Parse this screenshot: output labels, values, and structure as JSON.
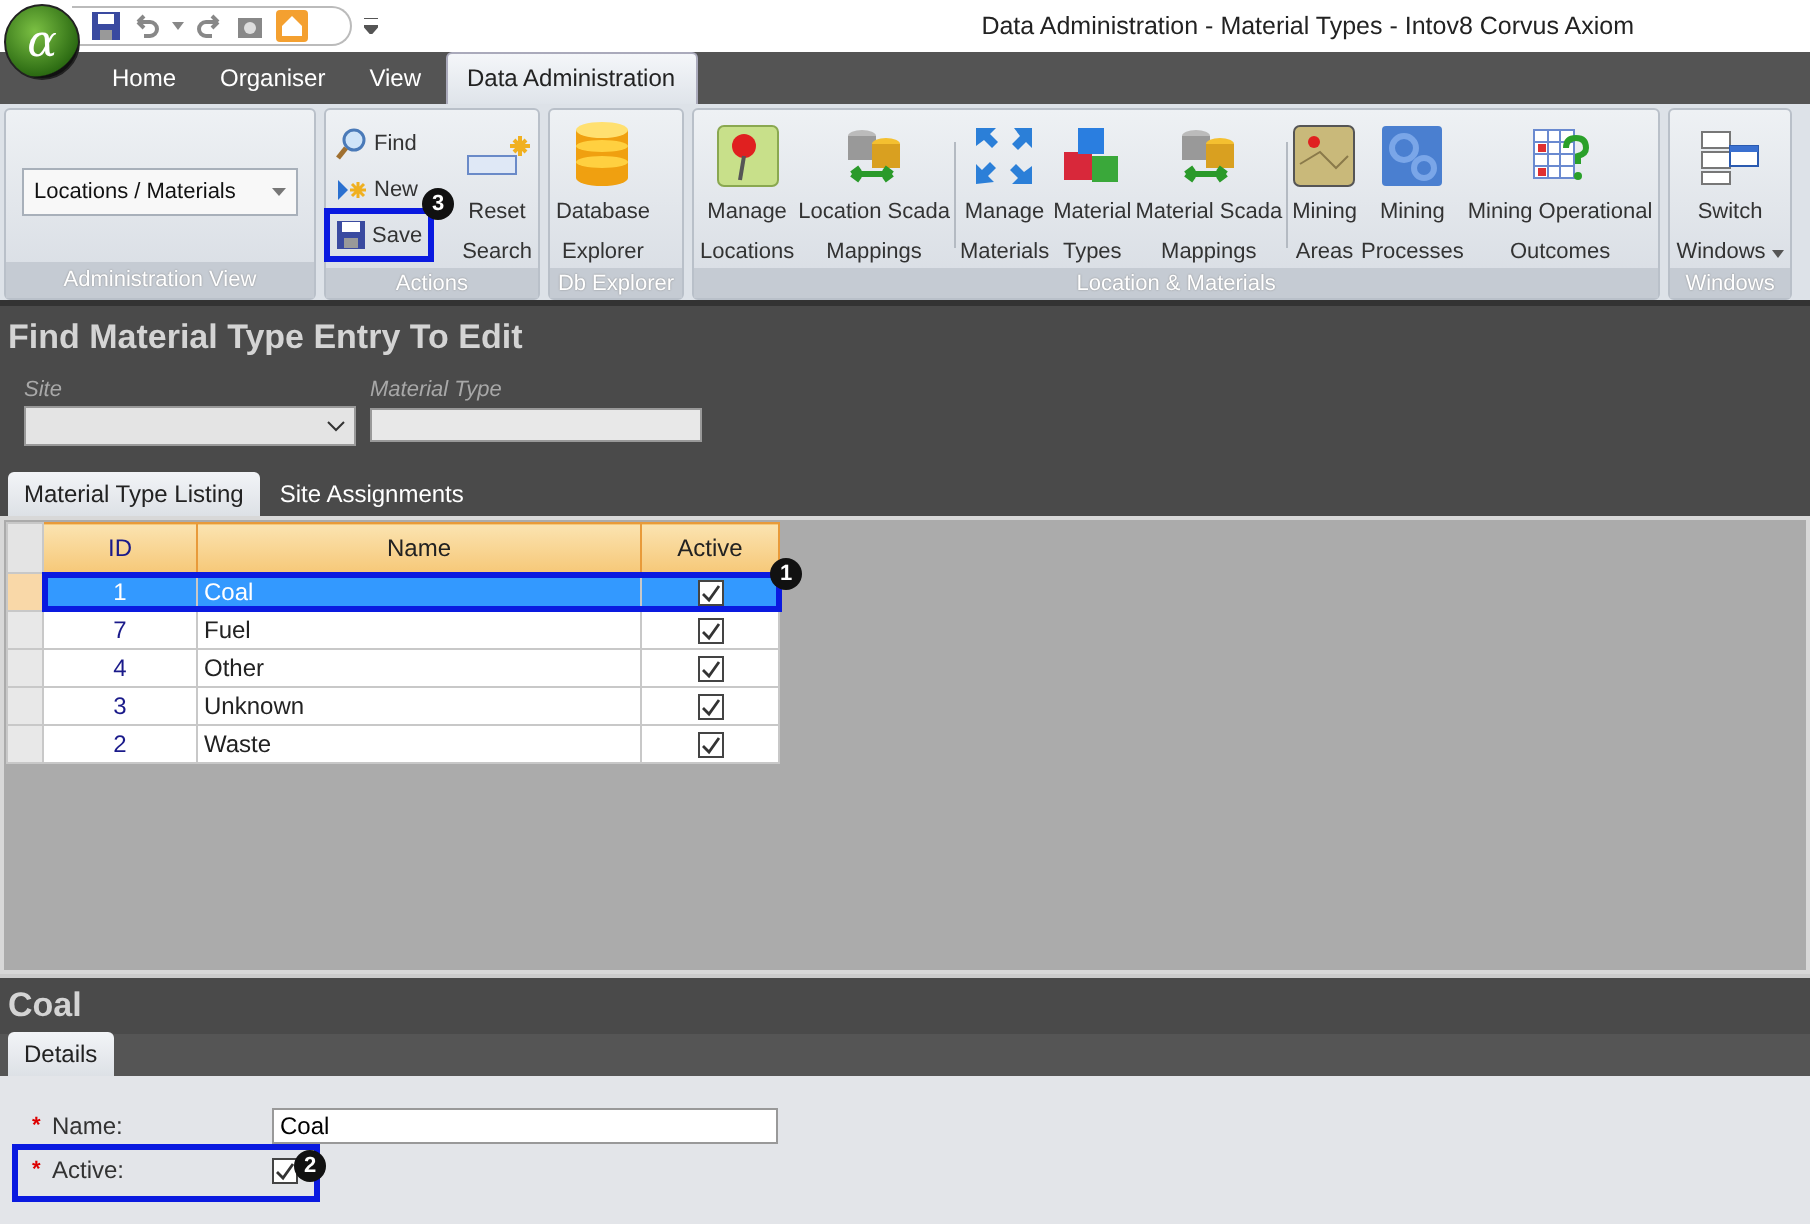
{
  "window": {
    "title": "Data Administration - Material Types - Intov8 Corvus Axiom",
    "app_glyph": "α"
  },
  "ribbon": {
    "tabs": [
      {
        "label": "Home",
        "selected": false
      },
      {
        "label": "Organiser",
        "selected": false
      },
      {
        "label": "View",
        "selected": false
      },
      {
        "label": "Data Administration",
        "selected": true
      }
    ],
    "groups": [
      {
        "kind": "dropdown",
        "title": "Administration View",
        "value": "Locations / Materials"
      },
      {
        "kind": "actions",
        "title": "Actions",
        "small": [
          {
            "label": "Find"
          },
          {
            "label": "New"
          },
          {
            "label": "Save",
            "callout": "3"
          }
        ],
        "large": [
          {
            "lines": [
              "Reset",
              "Search"
            ]
          }
        ]
      },
      {
        "kind": "large",
        "title": "Db Explorer",
        "buttons": [
          {
            "lines": [
              "Database",
              "Explorer"
            ]
          }
        ]
      },
      {
        "kind": "large",
        "title": "Location & Materials",
        "buttons": [
          {
            "lines": [
              "Manage",
              "Locations"
            ]
          },
          {
            "lines": [
              "Location Scada",
              "Mappings"
            ],
            "separator_after": true
          },
          {
            "lines": [
              "Manage",
              "Materials"
            ]
          },
          {
            "lines": [
              "Material",
              "Types"
            ]
          },
          {
            "lines": [
              "Material Scada",
              "Mappings"
            ],
            "separator_after": true
          },
          {
            "lines": [
              "Mining",
              "Areas"
            ]
          },
          {
            "lines": [
              "Mining",
              "Processes"
            ]
          },
          {
            "lines": [
              "Mining Operational",
              "Outcomes"
            ]
          }
        ]
      },
      {
        "kind": "large",
        "title": "Windows",
        "buttons": [
          {
            "lines": [
              "Switch",
              "Windows"
            ],
            "dropdown": true
          }
        ]
      }
    ]
  },
  "find": {
    "heading": "Find Material Type Entry To Edit",
    "site": {
      "label": "Site"
    },
    "material_type": {
      "label": "Material Type"
    }
  },
  "listing_tabs": [
    {
      "label": "Material Type Listing",
      "selected": true
    },
    {
      "label": "Site Assignments",
      "selected": false
    }
  ],
  "table": {
    "columns": [
      "ID",
      "Name",
      "Active"
    ],
    "rows": [
      {
        "id": "1",
        "name": "Coal",
        "active": true,
        "selected": true,
        "callout": "1"
      },
      {
        "id": "7",
        "name": "Fuel",
        "active": true,
        "selected": false
      },
      {
        "id": "4",
        "name": "Other",
        "active": true,
        "selected": false
      },
      {
        "id": "3",
        "name": "Unknown",
        "active": true,
        "selected": false
      },
      {
        "id": "2",
        "name": "Waste",
        "active": true,
        "selected": false
      }
    ]
  },
  "detail": {
    "heading": "Coal",
    "tabs": [
      {
        "label": "Details",
        "selected": true
      }
    ],
    "fields": [
      {
        "kind": "text",
        "label": "Name:",
        "required": "*",
        "value": "Coal"
      },
      {
        "kind": "checkbox",
        "label": "Active:",
        "required": "*",
        "checked": true,
        "callout": "2"
      }
    ]
  }
}
